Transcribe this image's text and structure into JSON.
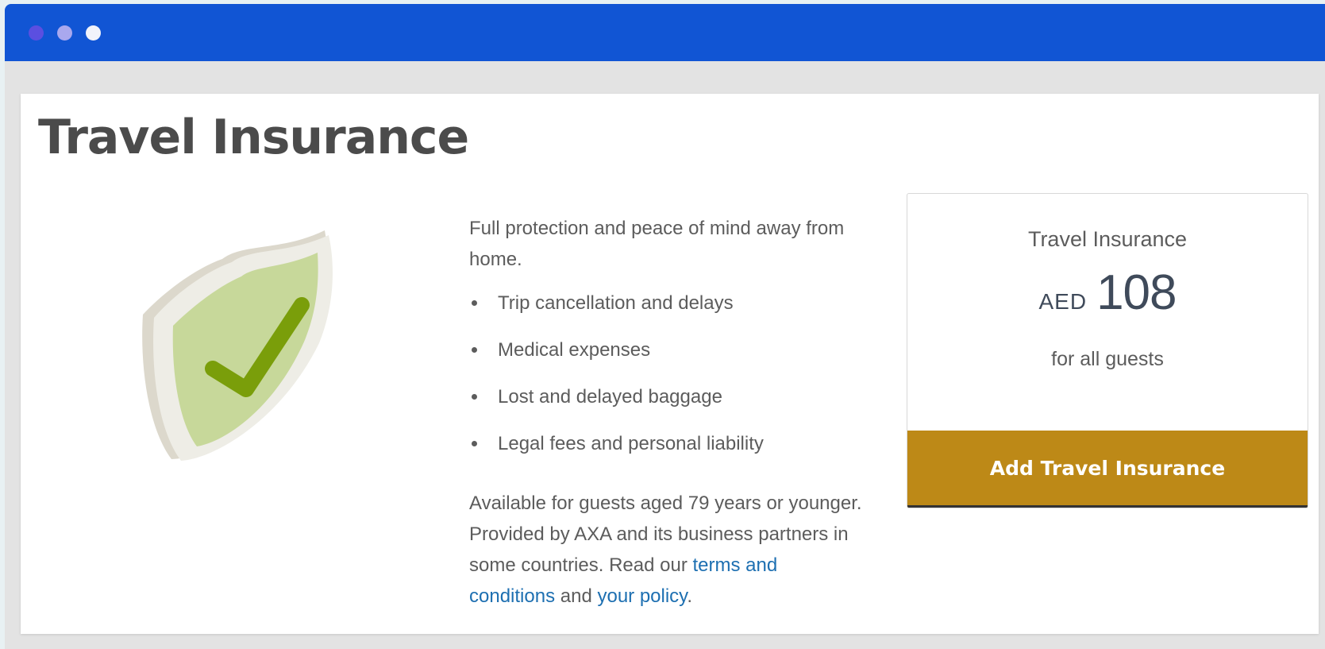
{
  "window": {
    "controls": [
      "close-dot",
      "minimize-dot",
      "maximize-dot"
    ]
  },
  "page": {
    "title": "Travel Insurance"
  },
  "description": {
    "intro": "Full protection and peace of mind away from home.",
    "benefits": [
      "Trip cancellation and delays",
      "Medical expenses",
      "Lost and delayed baggage",
      "Legal fees and personal liability"
    ],
    "availability_text": "Available for guests aged 79 years or younger. Provided by AXA and its business partners in some countries. Read our",
    "terms_link": "terms and conditions",
    "and_text": "and",
    "policy_link": "your policy",
    "end_punct": "."
  },
  "price_card": {
    "label": "Travel Insurance",
    "currency": "AED",
    "amount": "108",
    "note": "for all guests",
    "button_label": "Add Travel Insurance"
  },
  "colors": {
    "titlebar": "#1155d4",
    "button": "#bd8917",
    "link": "#1d6fb1",
    "shield_fill": "#c7d89a",
    "check": "#7a9e0a"
  },
  "icons": {
    "illustration": "shield-check-icon"
  }
}
